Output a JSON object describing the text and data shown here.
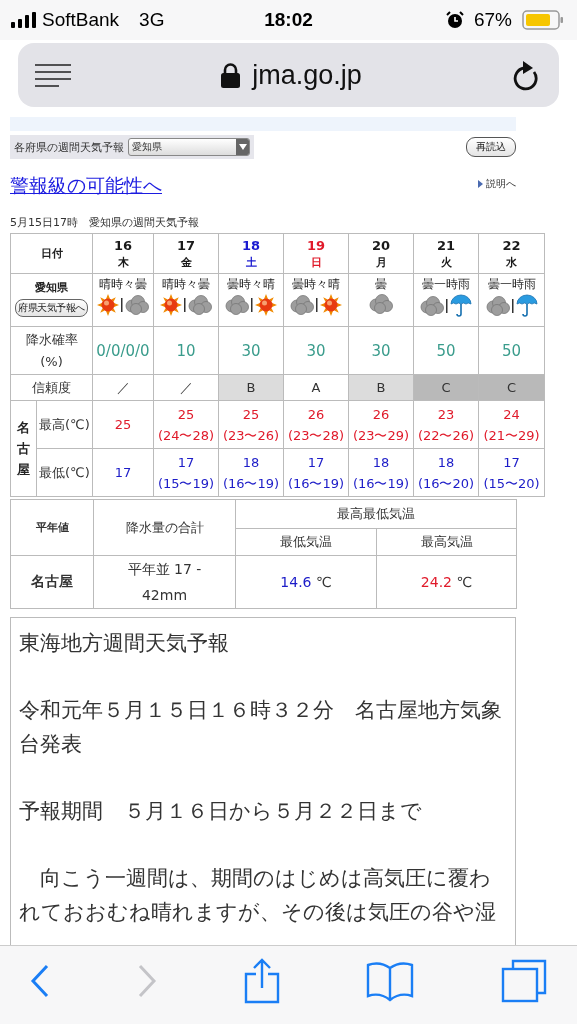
{
  "status_bar": {
    "carrier": "SoftBank",
    "network": "3G",
    "time": "18:02",
    "battery": "67%"
  },
  "address_bar": {
    "url": "jma.go.jp"
  },
  "selector": {
    "label": "各府県の週間天気予報",
    "value": "愛知県"
  },
  "reload_button": "再読込",
  "warning_link": "警報級の可能性へ",
  "help_link": "説明へ",
  "caption": "5月15日17時　愛知県の週間天気予報",
  "forecast": {
    "date_header": "日付",
    "region": "愛知県",
    "region_button": "府県天気予報へ",
    "pop_header": [
      "降水確率",
      "(%)"
    ],
    "reliability_header": "信頼度",
    "city": "名古屋",
    "max_header": "最高(℃)",
    "min_header": "最低(℃)",
    "days": [
      {
        "date": "16",
        "weekday": "木",
        "color": "#1a1a1a",
        "weather": "晴時々曇",
        "icons": [
          {
            "kind": "sun"
          },
          {
            "kind": "cloud"
          }
        ],
        "pop": "0/0/0/0",
        "reliability": {
          "text": "／",
          "kind": "plain"
        },
        "max": "25",
        "min": "17"
      },
      {
        "date": "17",
        "weekday": "金",
        "color": "#1a1a1a",
        "weather": "晴時々曇",
        "icons": [
          {
            "kind": "sun"
          },
          {
            "kind": "cloud"
          }
        ],
        "pop": "10",
        "reliability": {
          "text": "／",
          "kind": "plain"
        },
        "max": "25",
        "max_range": "(24〜28)",
        "min": "17",
        "min_range": "(15〜19)"
      },
      {
        "date": "18",
        "weekday": "土",
        "color": "#1a1ad0",
        "weather": "曇時々晴",
        "icons": [
          {
            "kind": "cloud"
          },
          {
            "kind": "sun"
          }
        ],
        "pop": "30",
        "reliability": {
          "text": "B",
          "kind": "light"
        },
        "max": "25",
        "max_range": "(23〜26)",
        "min": "18",
        "min_range": "(16〜19)"
      },
      {
        "date": "19",
        "weekday": "日",
        "color": "#e01a2a",
        "weather": "曇時々晴",
        "icons": [
          {
            "kind": "cloud"
          },
          {
            "kind": "sun"
          }
        ],
        "pop": "30",
        "reliability": {
          "text": "A",
          "kind": "plain"
        },
        "max": "26",
        "max_range": "(23〜28)",
        "min": "17",
        "min_range": "(16〜19)"
      },
      {
        "date": "20",
        "weekday": "月",
        "color": "#1a1a1a",
        "weather": "曇",
        "icons": [
          {
            "kind": "cloud"
          }
        ],
        "pop": "30",
        "reliability": {
          "text": "B",
          "kind": "light"
        },
        "max": "26",
        "max_range": "(23〜29)",
        "min": "18",
        "min_range": "(16〜19)"
      },
      {
        "date": "21",
        "weekday": "火",
        "color": "#1a1a1a",
        "weather": "曇一時雨",
        "icons": [
          {
            "kind": "cloud"
          },
          {
            "kind": "umbrella"
          }
        ],
        "pop": "50",
        "reliability": {
          "text": "C",
          "kind": "dark"
        },
        "max": "23",
        "max_range": "(22〜26)",
        "min": "18",
        "min_range": "(16〜20)"
      },
      {
        "date": "22",
        "weekday": "水",
        "color": "#1a1a1a",
        "weather": "曇一時雨",
        "icons": [
          {
            "kind": "cloud"
          },
          {
            "kind": "umbrella"
          }
        ],
        "pop": "50",
        "reliability": {
          "text": "C",
          "kind": "dark"
        },
        "max": "24",
        "max_range": "(21〜29)",
        "min": "17",
        "min_range": "(15〜20)"
      }
    ]
  },
  "normals": {
    "header": "平年値",
    "precip_header": "降水量の合計",
    "temp_header": "最高最低気温",
    "min_header": "最低気温",
    "max_header": "最高気温",
    "city": "名古屋",
    "precip": "平年並 17 - 42mm",
    "min": "14.6",
    "max": "24.2",
    "unit": "℃"
  },
  "bulletin": {
    "paragraphs": [
      "東海地方週間天気予報",
      "令和元年５月１５日１６時３２分　名古屋地方気象台発表",
      "予報期間　５月１６日から５月２２日まで",
      "　向こう一週間は、期間のはじめは高気圧に覆われておおむね晴れますが、その後は気圧の谷や湿"
    ]
  },
  "toolbar": {
    "back_enabled": true,
    "forward_enabled": false
  }
}
